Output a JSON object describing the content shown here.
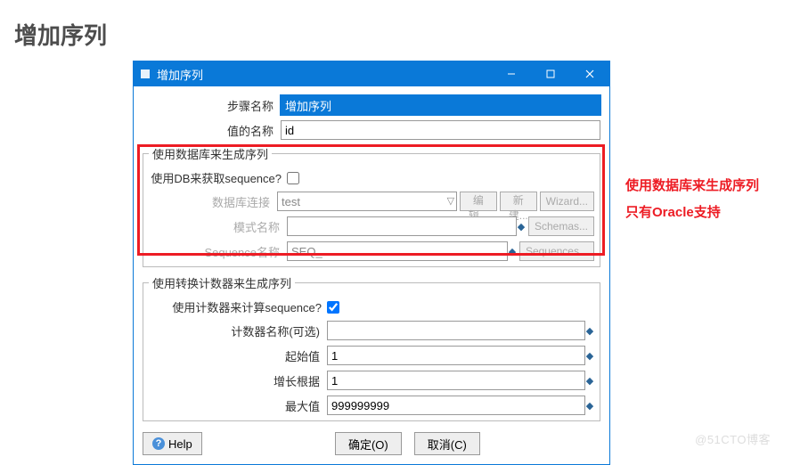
{
  "page": {
    "heading": "增加序列"
  },
  "window": {
    "title": "增加序列"
  },
  "fields": {
    "step_name": {
      "label": "步骤名称",
      "value": "增加序列"
    },
    "value_name": {
      "label": "值的名称",
      "value": "id"
    }
  },
  "group_db": {
    "legend": "使用数据库来生成序列",
    "use_db": {
      "label": "使用DB来获取sequence?",
      "checked": false
    },
    "connection": {
      "label": "数据库连接",
      "value": "test",
      "btn_edit": "编辑...",
      "btn_new": "新建...",
      "btn_wizard": "Wizard..."
    },
    "schema": {
      "label": "模式名称",
      "value": "",
      "btn": "Schemas..."
    },
    "seq": {
      "label": "Sequence名称",
      "value": "SEQ_",
      "btn": "Sequences..."
    }
  },
  "group_counter": {
    "legend": "使用转换计数器来生成序列",
    "use_counter": {
      "label": "使用计数器来计算sequence?",
      "checked": true
    },
    "counter_name": {
      "label": "计数器名称(可选)",
      "value": ""
    },
    "start": {
      "label": "起始值",
      "value": "1"
    },
    "increment": {
      "label": "增长根据",
      "value": "1"
    },
    "max": {
      "label": "最大值",
      "value": "999999999"
    }
  },
  "buttons": {
    "help": "Help",
    "ok": "确定(O)",
    "cancel": "取消(C)"
  },
  "annotation": {
    "line1": "使用数据库来生成序列",
    "line2": "只有Oracle支持"
  },
  "watermark": "@51CTO博客"
}
